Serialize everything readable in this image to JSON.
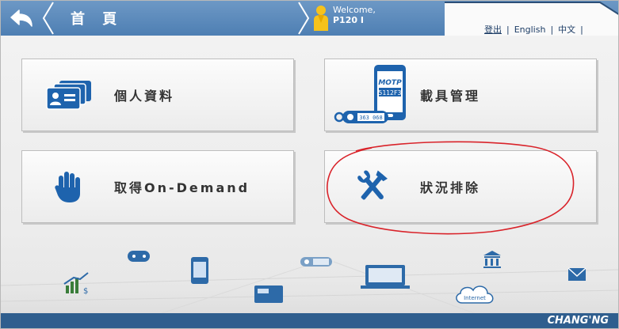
{
  "header": {
    "title": "首 頁",
    "welcome": "Welcome,",
    "user_id": "P120 I",
    "links": {
      "logout": "登出",
      "english": "English",
      "chinese": "中文"
    }
  },
  "tiles": [
    {
      "label": "個人資料",
      "icon": "id-card-icon"
    },
    {
      "label": "載具管理",
      "icon": "carrier-device-icon",
      "device_text": "MOTP",
      "device_code": "5112F3",
      "tag_code": "363 068"
    },
    {
      "label": "取得On-Demand",
      "icon": "hand-stop-icon"
    },
    {
      "label": "狀況排除",
      "icon": "tools-icon"
    }
  ],
  "bottom_icons": {
    "internet_label": "Internet"
  },
  "footer": {
    "brand": "CHANG'NG"
  },
  "colors": {
    "header_blue": "#5686b9",
    "footer_blue": "#2f5e8e",
    "icon_blue": "#1e63ad",
    "annotation_red": "#d9232a"
  }
}
